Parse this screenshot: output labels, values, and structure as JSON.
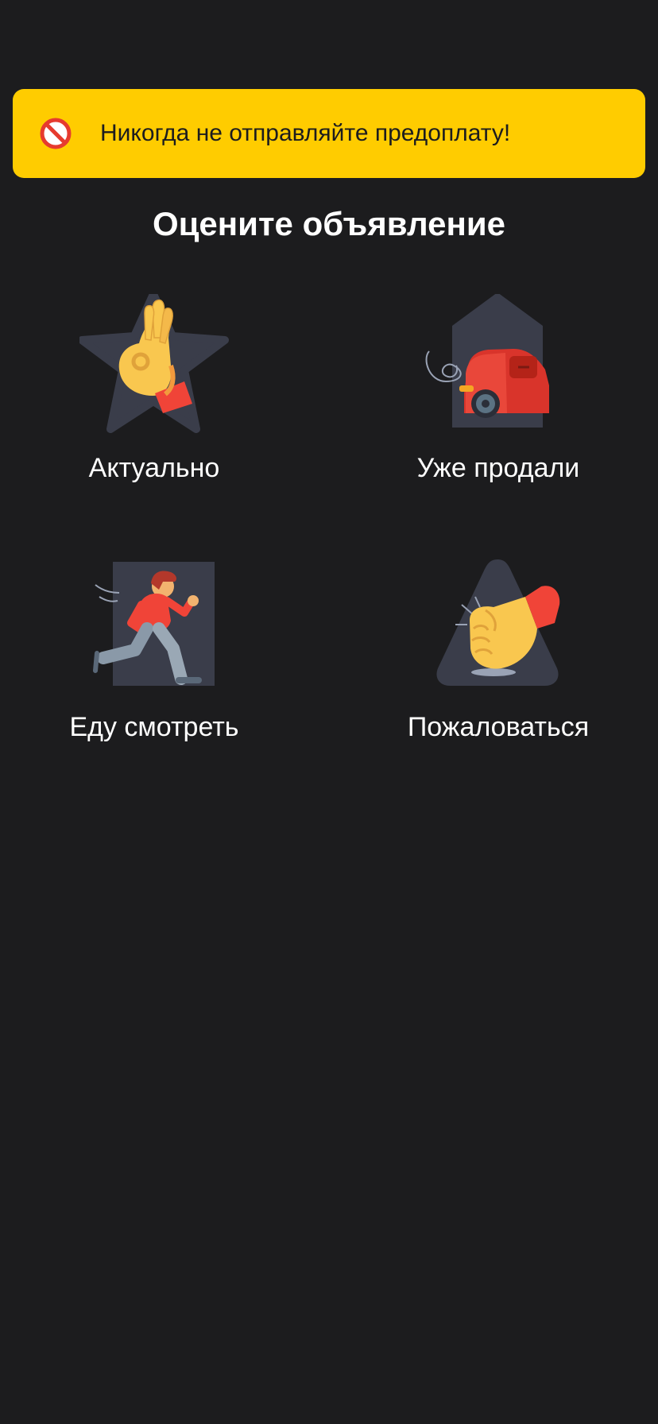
{
  "warning": {
    "text": "Никогда не отправляйте предоплату!",
    "icon": "prohibited-icon",
    "background": "#ffcc00"
  },
  "title": "Оцените объявление",
  "options": [
    {
      "label": "Актуально",
      "icon": "ok-hand-star-icon"
    },
    {
      "label": "Уже продали",
      "icon": "car-leaving-icon"
    },
    {
      "label": "Еду смотреть",
      "icon": "running-man-icon"
    },
    {
      "label": "Пожаловаться",
      "icon": "fist-bang-icon"
    }
  ],
  "colors": {
    "background": "#1c1c1e",
    "accent": "#ffcc00",
    "icon_backdrop": "#3a3d4a"
  }
}
